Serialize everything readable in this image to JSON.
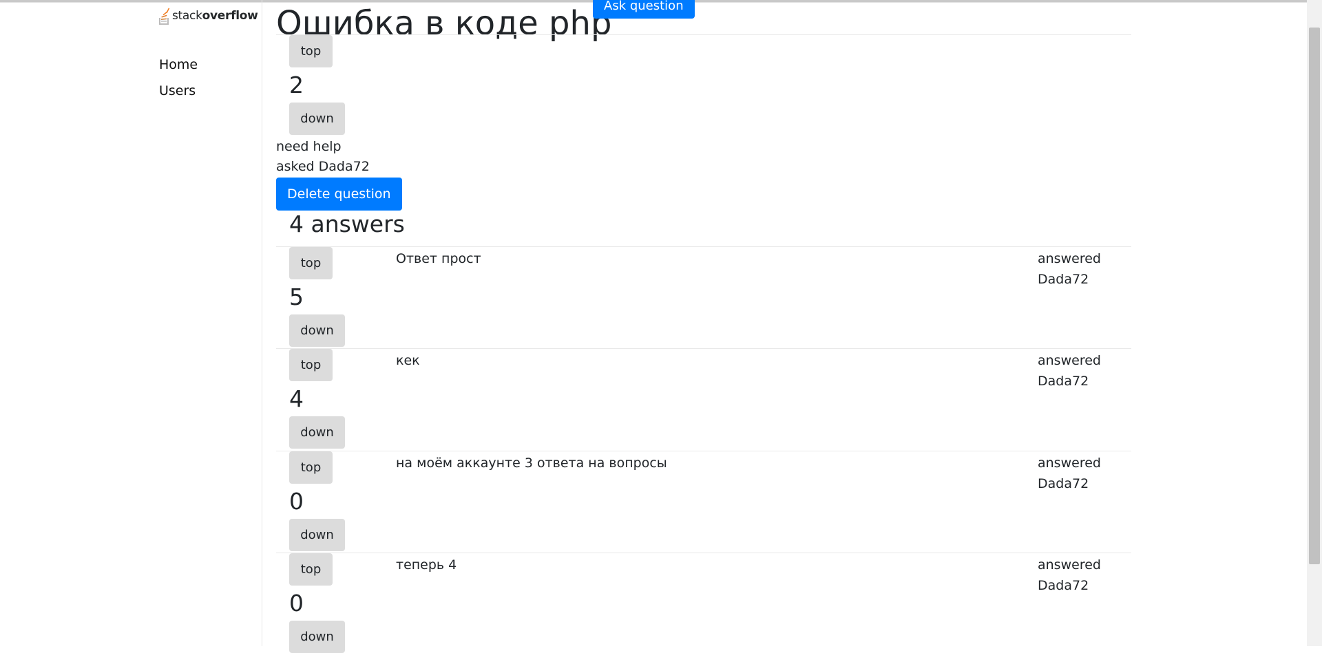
{
  "brand": {
    "name_light": "stack",
    "name_bold": "overflow"
  },
  "nav": {
    "home": "Home",
    "users": "Users"
  },
  "question": {
    "title": "Ошибка в коде php",
    "ask_label": "Ask question",
    "vote_up_label": "top",
    "vote_down_label": "down",
    "votes": "2",
    "body": "need help",
    "asked": "asked Dada72",
    "delete_label": "Delete question"
  },
  "answers_heading": "4 answers",
  "answers": [
    {
      "text": "Ответ прост",
      "votes": "5",
      "meta_line1": "answered",
      "meta_line2": "Dada72",
      "up_label": "top",
      "down_label": "down"
    },
    {
      "text": "кек",
      "votes": "4",
      "meta_line1": "answered",
      "meta_line2": "Dada72",
      "up_label": "top",
      "down_label": "down"
    },
    {
      "text": "на моём аккаунте 3 ответа на вопросы",
      "votes": "0",
      "meta_line1": "answered",
      "meta_line2": "Dada72",
      "up_label": "top",
      "down_label": "down"
    },
    {
      "text": "теперь 4",
      "votes": "0",
      "meta_line1": "answered",
      "meta_line2": "Dada72",
      "up_label": "top",
      "down_label": "down"
    }
  ],
  "colors": {
    "primary": "#007bff",
    "vote_button": "#dcdcdc",
    "logo_accent": "#f48024"
  }
}
